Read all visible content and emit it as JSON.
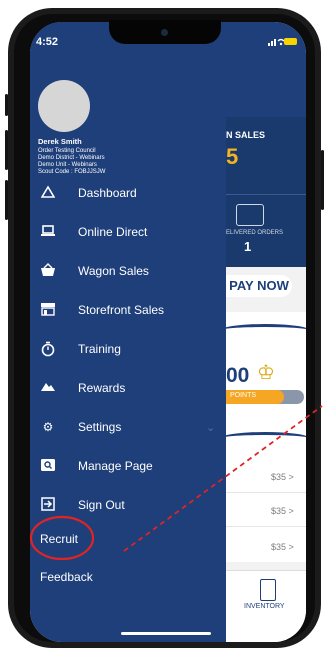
{
  "status_bar": {
    "time": "4:52"
  },
  "user": {
    "name": "Derek Smith",
    "lines": [
      "Order Testing Council",
      "Demo District - Webinars",
      "Demo Unit - Webinars",
      "Scout Code : FOBJJSJW"
    ]
  },
  "menu": {
    "items": [
      {
        "label": "Dashboard",
        "icon": "triangle-icon"
      },
      {
        "label": "Online Direct",
        "icon": "laptop-icon"
      },
      {
        "label": "Wagon Sales",
        "icon": "basket-icon"
      },
      {
        "label": "Storefront Sales",
        "icon": "storefront-icon"
      },
      {
        "label": "Training",
        "icon": "stopwatch-icon"
      },
      {
        "label": "Rewards",
        "icon": "mountain-icon"
      },
      {
        "label": "Settings",
        "icon": "gear-icon"
      },
      {
        "label": "Manage Page",
        "icon": "search-card-icon"
      },
      {
        "label": "Sign Out",
        "icon": "sign-out-icon"
      }
    ],
    "recruit": "Recruit",
    "feedback": "Feedback"
  },
  "background": {
    "sales_label": "N SALES",
    "sales_value": "5",
    "delivered_label": "ELIVERED ORDERS",
    "delivered_value": "1",
    "pay_now": "PAY NOW",
    "points_value": "00",
    "points_label": "POINTS",
    "prices": [
      "$35 >",
      "$35 >",
      "$35 >"
    ],
    "inventory": "INVENTORY"
  },
  "colors": {
    "drawer": "#1e3f7a",
    "annotation": "#e02424",
    "points": "#f5a623"
  }
}
